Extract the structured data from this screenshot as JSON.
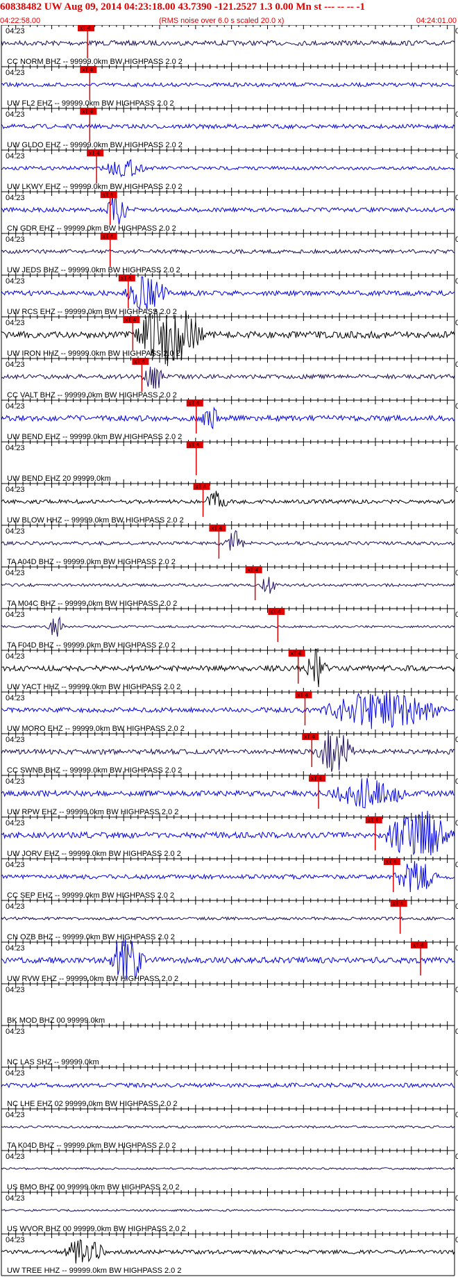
{
  "header": {
    "title": "60838482 UW Aug 09, 2014 04:23:18.00   43.7390 -121.2527  1.3 0.00 Mn st --- -- --   -1",
    "start_time": "04:22:58.00",
    "subtitle": "(RMS noise over 6.0 s scaled 20.0 x)",
    "end_time": "04:24:01.00"
  },
  "colors": {
    "pick": "#e00000",
    "black": "#000000",
    "blue": "#0000e0",
    "navy": "#1a0a5a",
    "axis": "#000000"
  },
  "chart_data": {
    "type": "seismogram",
    "time_range": [
      "04:22:58.00",
      "04:24:01.00"
    ],
    "minute_label": "04:23",
    "pick_label": "xT 4",
    "trace_end_label": "0",
    "traces": [
      {
        "label": "CC NORM BHZ -- 99999.0km BW  HIGHPASS  2.0  2",
        "color": "navy",
        "amp": 0.25,
        "pick": 0.19,
        "burst": null
      },
      {
        "label": "UW FL2 EHZ -- 99999.0km BW  HIGHPASS  2.0  2",
        "color": "blue",
        "amp": 0.2,
        "pick": 0.195,
        "burst": null
      },
      {
        "label": "UW GLDO EHZ -- 99999.0km BW  HIGHPASS  2.0  2",
        "color": "blue",
        "amp": 0.22,
        "pick": 0.195,
        "burst": null
      },
      {
        "label": "UW LKWY EHZ -- 99999.0km BW  HIGHPASS  2.0  2",
        "color": "blue",
        "amp": 0.18,
        "pick": 0.21,
        "burst": [
          0.22,
          0.32,
          1.1
        ]
      },
      {
        "label": "CN GDR EHZ -- 99999.0km BW  HIGHPASS  2.0  2",
        "color": "blue",
        "amp": 0.22,
        "pick": 0.24,
        "burst": [
          0.23,
          0.28,
          1.8
        ]
      },
      {
        "label": "UW JEDS BHZ -- 99999.0km BW  HIGHPASS  2.0  2",
        "color": "navy",
        "amp": 0.2,
        "pick": 0.24,
        "burst": null
      },
      {
        "label": "UW RCS EHZ -- 99999.0km BW  HIGHPASS  2.0  2",
        "color": "blue",
        "amp": 0.25,
        "pick": 0.28,
        "burst": [
          0.27,
          0.37,
          1.6
        ]
      },
      {
        "label": "UW IRON HHZ -- 99999.0km BW  HIGHPASS  2.0  2",
        "color": "black",
        "amp": 0.35,
        "pick": 0.29,
        "burst": [
          0.29,
          0.45,
          2.2
        ]
      },
      {
        "label": "CC VALT BHZ -- 99999.0km BW  HIGHPASS  2.0  2",
        "color": "navy",
        "amp": 0.22,
        "pick": 0.31,
        "burst": [
          0.31,
          0.36,
          1.6
        ]
      },
      {
        "label": "UW BEND EHZ -- 99999.0km BW  HIGHPASS  2.0  2",
        "color": "blue",
        "amp": 0.28,
        "pick": 0.43,
        "burst": [
          0.44,
          0.48,
          1.2
        ]
      },
      {
        "label": "UW BEND EHZ 20 99999.0km",
        "color": "blue",
        "amp": 0.0,
        "pick": 0.43,
        "burst": null
      },
      {
        "label": "UW BLOW HHZ -- 99999.0km BW  HIGHPASS  2.0  2",
        "color": "black",
        "amp": 0.2,
        "pick": 0.445,
        "burst": [
          0.45,
          0.5,
          1.5
        ]
      },
      {
        "label": "TA A04D BHZ -- 99999.0km BW  HIGHPASS  2.0  2",
        "color": "navy",
        "amp": 0.18,
        "pick": 0.48,
        "burst": [
          0.49,
          0.54,
          1.6
        ]
      },
      {
        "label": "TA M04C BHZ -- 99999.0km BW  HIGHPASS  2.0  2",
        "color": "navy",
        "amp": 0.15,
        "pick": 0.56,
        "burst": [
          0.57,
          0.61,
          1.5
        ]
      },
      {
        "label": "TA F04D BHZ -- 99999.0km BW  HIGHPASS  2.0  2",
        "color": "navy",
        "amp": 0.12,
        "pick": 0.61,
        "burst": [
          0.1,
          0.14,
          2.2
        ]
      },
      {
        "label": "UW YACT HHZ -- 99999.0km BW  HIGHPASS  2.0  2",
        "color": "black",
        "amp": 0.28,
        "pick": 0.655,
        "burst": [
          0.67,
          0.72,
          1.6
        ]
      },
      {
        "label": "UW MORO EHZ -- 99999.0km BW  HIGHPASS  2.0  2",
        "color": "blue",
        "amp": 0.25,
        "pick": 0.67,
        "burst": [
          0.7,
          0.98,
          1.8
        ]
      },
      {
        "label": "CC SWNB BHZ -- 99999.0km BW  HIGHPASS  2.0  2",
        "color": "navy",
        "amp": 0.25,
        "pick": 0.685,
        "burst": [
          0.69,
          0.78,
          2.2
        ]
      },
      {
        "label": "UW RPW EHZ -- 99999.0km BW  HIGHPASS  2.0  2",
        "color": "blue",
        "amp": 0.28,
        "pick": 0.7,
        "burst": [
          0.72,
          0.9,
          1.2
        ]
      },
      {
        "label": "UW JORV EHZ -- 99999.0km BW  HIGHPASS  2.0  2",
        "color": "blue",
        "amp": 0.3,
        "pick": 0.825,
        "burst": [
          0.84,
          1.0,
          2.0
        ]
      },
      {
        "label": "CC SEP EHZ -- 99999.0km BW  HIGHPASS  2.0  2",
        "color": "blue",
        "amp": 0.22,
        "pick": 0.865,
        "burst": [
          0.86,
          0.97,
          1.7
        ]
      },
      {
        "label": "CN OZB BHZ -- 99999.0km BW  HIGHPASS  2.0  2",
        "color": "navy",
        "amp": 0.15,
        "pick": 0.88,
        "burst": null
      },
      {
        "label": "UW RVW EHZ -- 99999.0km BW  HIGHPASS  2.0  2",
        "color": "blue",
        "amp": 0.3,
        "pick": 0.925,
        "burst": [
          0.23,
          0.32,
          1.8
        ]
      },
      {
        "label": "BK MOD BHZ 00 99999.0km",
        "color": "blue",
        "amp": 0.0,
        "pick": null,
        "burst": null
      },
      {
        "label": "NC LAS SHZ -- 99999.0km",
        "color": "blue",
        "amp": 0.0,
        "pick": null,
        "burst": null
      },
      {
        "label": "NC LHE EHZ 02 99999.0km BW  HIGHPASS  2.0  2",
        "color": "blue",
        "amp": 0.22,
        "pick": null,
        "burst": null
      },
      {
        "label": "TA K04D BHZ -- 99999.0km BW  HIGHPASS  2.0  2",
        "color": "navy",
        "amp": 0.12,
        "pick": null,
        "burst": null
      },
      {
        "label": "US BMO BHZ 00 99999.0km BW  HIGHPASS  2.0  2",
        "color": "navy",
        "amp": 0.1,
        "pick": null,
        "burst": null
      },
      {
        "label": "US WVOR BHZ 00 99999.0km BW  HIGHPASS  2.0  2",
        "color": "navy",
        "amp": 0.1,
        "pick": null,
        "burst": null
      },
      {
        "label": "UW TREE HHZ -- 99999.0km BW  HIGHPASS  2.0  2",
        "color": "black",
        "amp": 0.2,
        "pick": null,
        "burst": [
          0.12,
          0.24,
          1.4
        ]
      }
    ]
  }
}
